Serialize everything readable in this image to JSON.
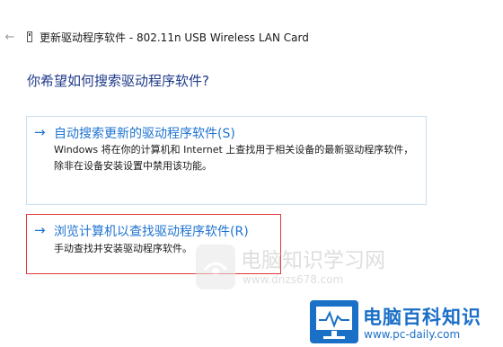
{
  "window": {
    "back_icon": "back-arrow-icon",
    "device_icon": "usb-device-icon",
    "title": "更新驱动程序软件 - 802.11n USB Wireless LAN Card"
  },
  "main": {
    "heading": "你希望如何搜索驱动程序软件?"
  },
  "options": {
    "auto": {
      "arrow": "→",
      "title": "自动搜索更新的驱动程序软件(S)",
      "description": "Windows 将在你的计算机和 Internet 上查找用于相关设备的最新驱动程序软件，除非在设备安装设置中禁用该功能。"
    },
    "browse": {
      "arrow": "→",
      "title": "浏览计算机以查找驱动程序软件(R)",
      "description": "手动查找并安装驱动程序软件。"
    }
  },
  "watermarks": {
    "dnzs": {
      "text": "电脑知识学习网",
      "url": "www.dnzs678.com"
    },
    "pcdaily": {
      "text": "电脑百科知识",
      "url": "www.pc-daily.com"
    }
  },
  "colors": {
    "link_blue": "#1e73d1",
    "heading_blue": "#1e3a8a",
    "card_border": "#c9dff3",
    "highlight_red": "#e23a3a",
    "pcdaily_blue": "#1a6fc7"
  }
}
